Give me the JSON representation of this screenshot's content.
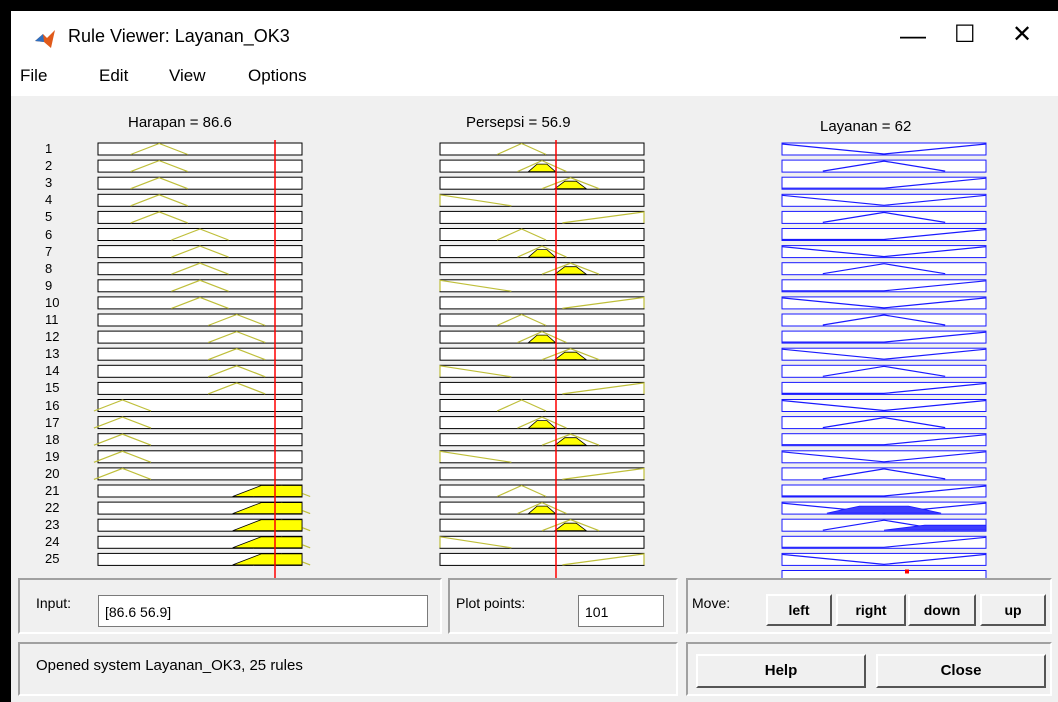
{
  "window": {
    "title": "Rule Viewer: Layanan_OK3",
    "minimize_glyph": "—",
    "maximize_glyph": "☐",
    "close_glyph": "✕"
  },
  "menu": {
    "items": [
      "File",
      "Edit",
      "View",
      "Options"
    ]
  },
  "columns": [
    {
      "header": "Harapan = 86.6"
    },
    {
      "header": "Persepsi = 56.9"
    },
    {
      "header": "Layanan = 62"
    }
  ],
  "rules": {
    "numbers": [
      "1",
      "2",
      "3",
      "4",
      "5",
      "6",
      "7",
      "8",
      "9",
      "10",
      "11",
      "12",
      "13",
      "14",
      "15",
      "16",
      "17",
      "18",
      "19",
      "20",
      "21",
      "22",
      "23",
      "24",
      "25"
    ]
  },
  "controls": {
    "input_label": "Input:",
    "input_value": "[86.6 56.9]",
    "plot_points_label": "Plot points:",
    "plot_points_value": "101",
    "move_label": "Move:",
    "move_left": "left",
    "move_right": "right",
    "move_down": "down",
    "move_up": "up",
    "status": "Opened system Layanan_OK3, 25 rules",
    "help": "Help",
    "close": "Close"
  },
  "colors": {
    "input_mf_fill": "#ffff00",
    "input_mf_line": "#bfbf3a",
    "output_mf_line": "#1a1aff",
    "output_mf_fill": "#3d3dff",
    "indicator_line": "#ff0000"
  }
}
